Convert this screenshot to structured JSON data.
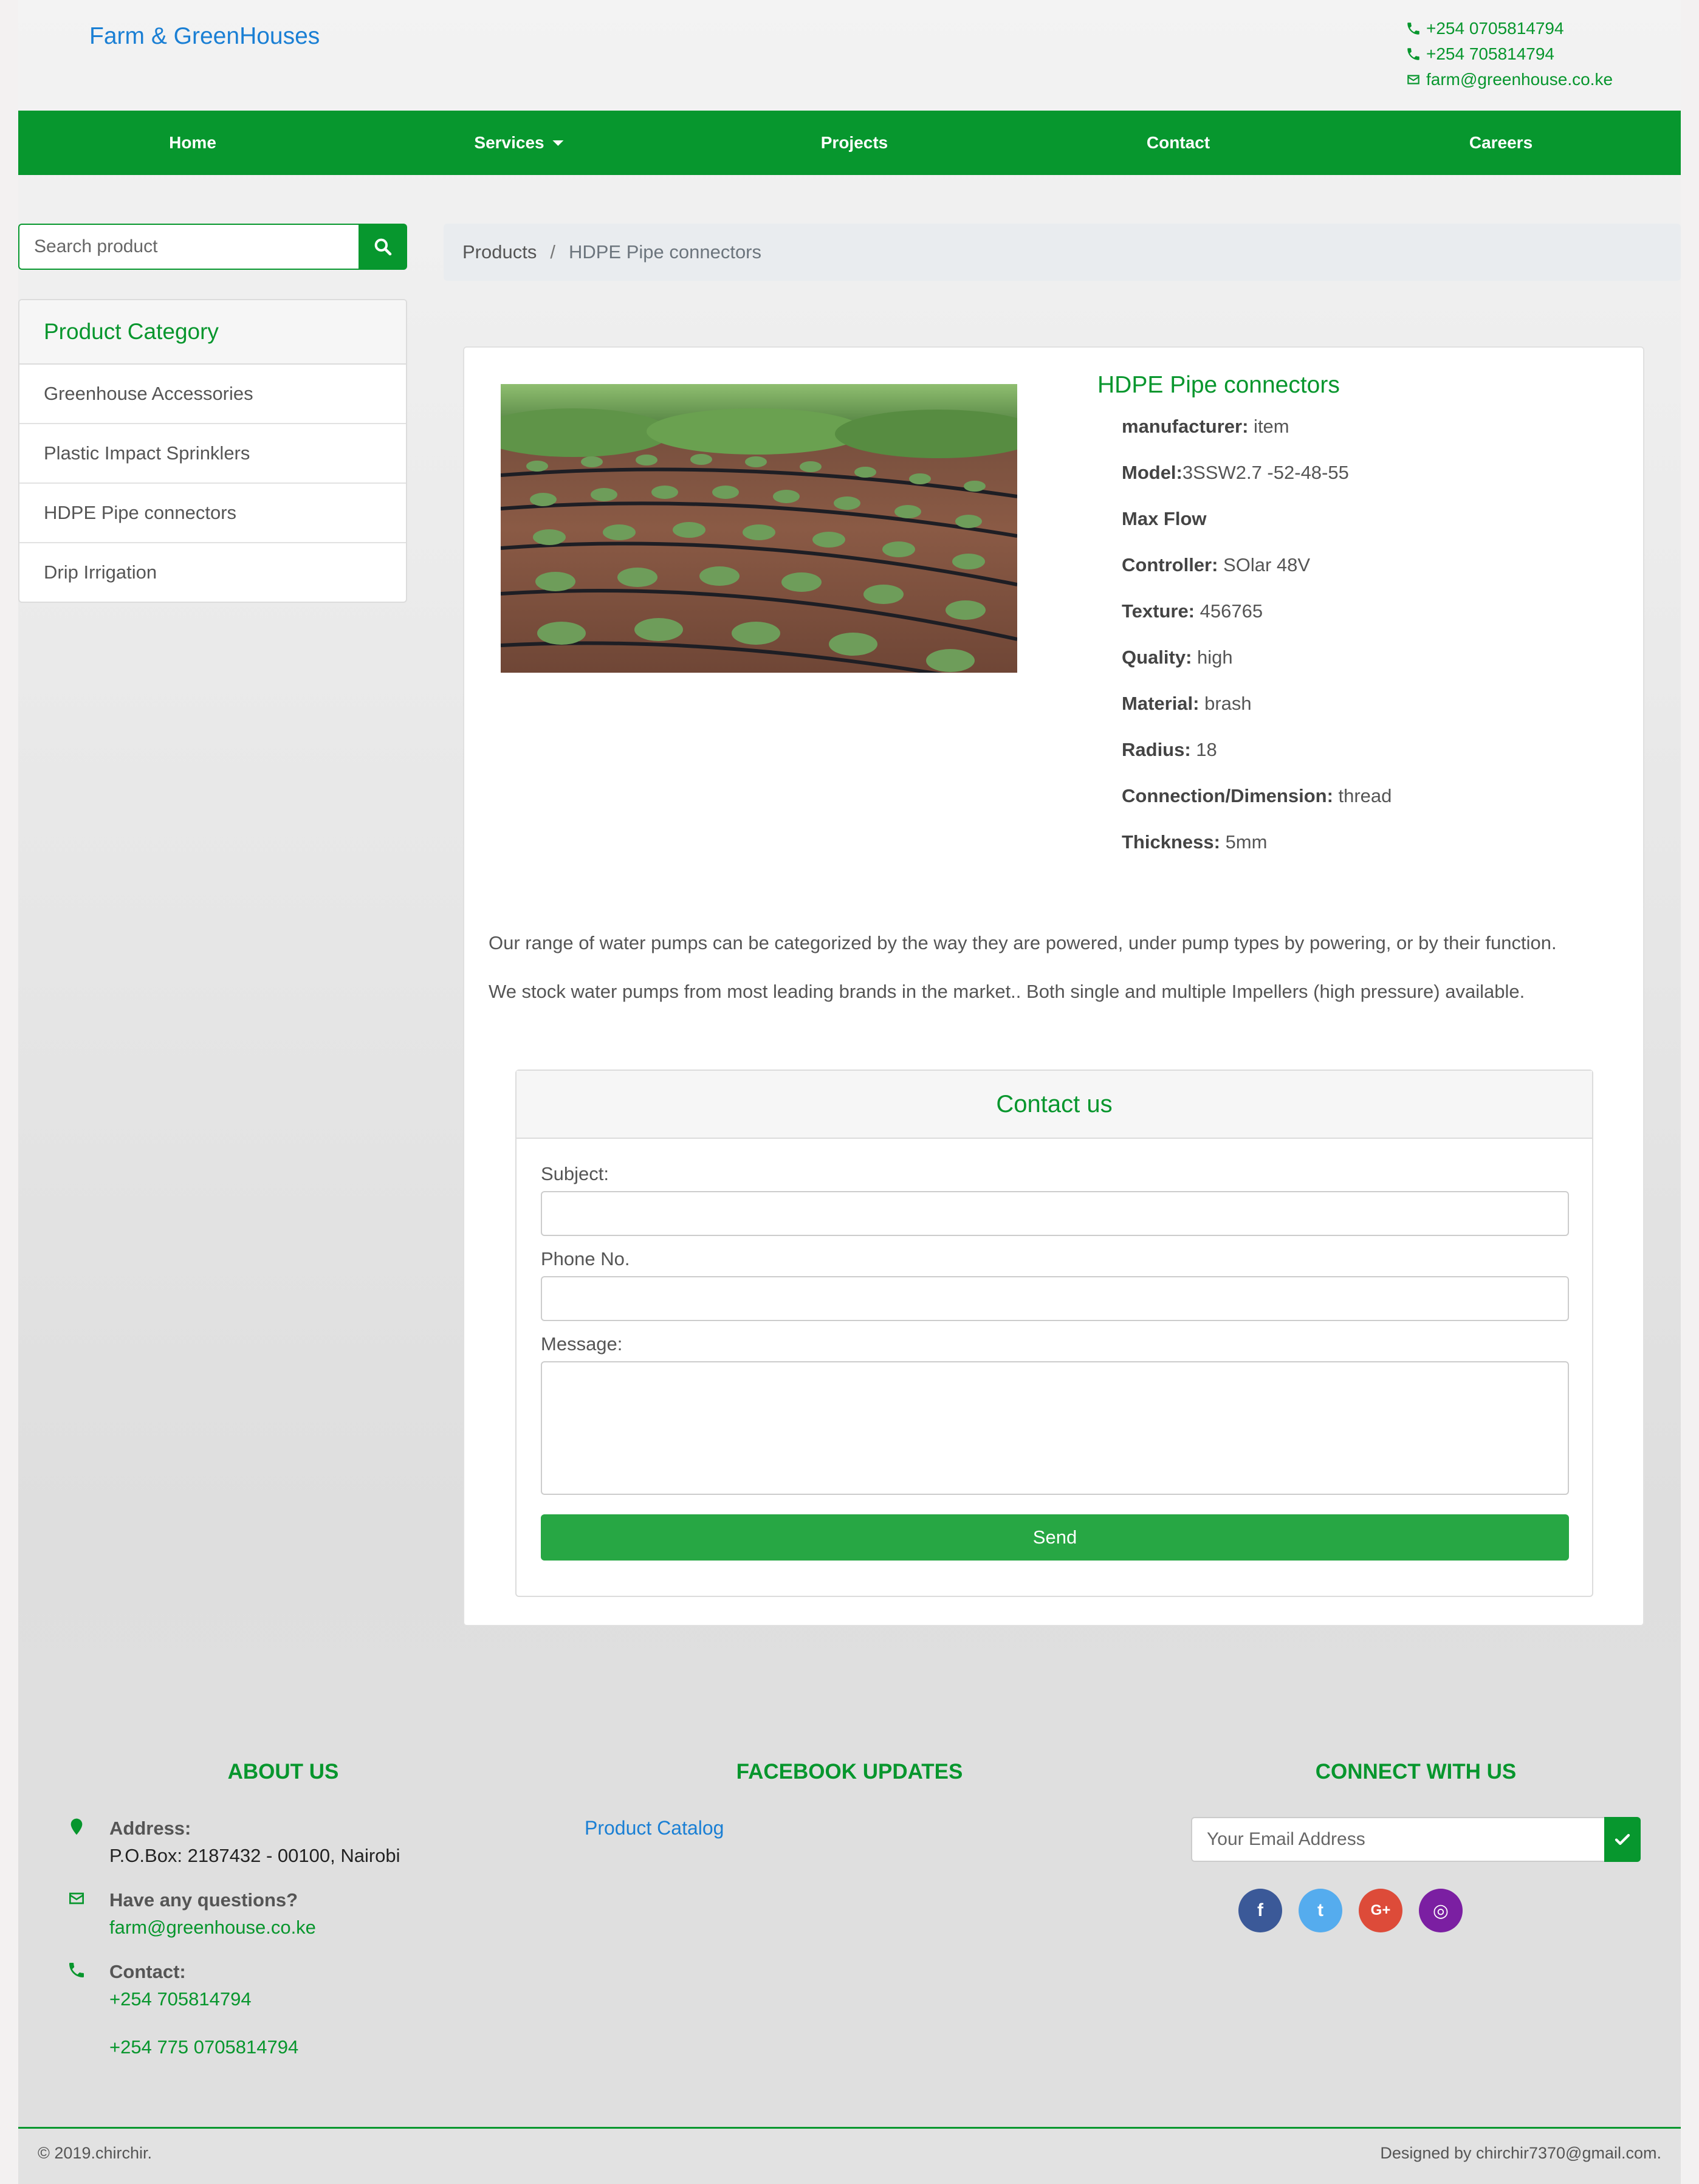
{
  "header": {
    "brand": "Farm & GreenHouses",
    "phone1": "+254 0705814794",
    "phone2": "+254 705814794",
    "email": "farm@greenhouse.co.ke"
  },
  "nav": {
    "home": "Home",
    "services": "Services",
    "projects": "Projects",
    "contact": "Contact",
    "careers": "Careers"
  },
  "search": {
    "placeholder": "Search product",
    "icon": "search-icon"
  },
  "sidebar": {
    "title": "Product Category",
    "items": [
      {
        "label": "Greenhouse Accessories"
      },
      {
        "label": "Plastic Impact Sprinklers"
      },
      {
        "label": "HDPE Pipe connectors"
      },
      {
        "label": "Drip Irrigation"
      }
    ]
  },
  "breadcrumb": {
    "root": "Products",
    "separator": "/",
    "current": "HDPE Pipe connectors"
  },
  "product": {
    "title": "HDPE Pipe connectors",
    "specs": [
      {
        "key": "manufacturer:",
        "value": " item"
      },
      {
        "key": "Model:",
        "value": "3SSW2.7 -52-48-55"
      },
      {
        "key": "Max Flow",
        "value": ""
      },
      {
        "key": "Controller:",
        "value": " SOlar 48V"
      },
      {
        "key": "Texture:",
        "value": " 456765"
      },
      {
        "key": "Quality:",
        "value": " high"
      },
      {
        "key": "Material:",
        "value": " brash"
      },
      {
        "key": "Radius:",
        "value": " 18"
      },
      {
        "key": "Connection/Dimension:",
        "value": " thread"
      },
      {
        "key": "Thickness:",
        "value": " 5mm"
      }
    ],
    "description": [
      "Our range of water pumps can be categorized by the way they are powered, under pump types by powering, or by their function.",
      "We stock water pumps from most leading brands in the market.. Both single and multiple Impellers (high pressure) available."
    ]
  },
  "contact_form": {
    "title": "Contact us",
    "subject_label": "Subject:",
    "phone_label": "Phone No.",
    "message_label": "Message:",
    "subject_value": "",
    "phone_value": "",
    "message_value": "",
    "send_label": "Send"
  },
  "footer": {
    "about_title": "ABOUT US",
    "address_label": "Address:",
    "address_value": "P.O.Box: 2187432 - 00100, Nairobi",
    "questions_label": "Have any questions?",
    "questions_value": "farm@greenhouse.co.ke",
    "contact_label": "Contact:",
    "contact_value1": "+254 705814794",
    "contact_value2": "+254 775 0705814794",
    "facebook_title": "FACEBOOK UPDATES",
    "catalog_link": "Product Catalog",
    "connect_title": "CONNECT WITH US",
    "email_placeholder": "Your Email Address",
    "socials": [
      {
        "icon": "facebook-icon",
        "glyph": "f",
        "color": "#3b5998"
      },
      {
        "icon": "twitter-icon",
        "glyph": "t",
        "color": "#55acee"
      },
      {
        "icon": "google-plus-icon",
        "glyph": "G+",
        "color": "#dd4b39"
      },
      {
        "icon": "instagram-icon",
        "glyph": "◎",
        "color": "#7b1fa2"
      }
    ],
    "copyright": "© 2019.chirchir.",
    "designed_by": "Designed by chirchir7370@gmail.com."
  },
  "colors": {
    "brand_green": "#07972e",
    "link_blue": "#1a7fd4",
    "send_green": "#27a744"
  }
}
